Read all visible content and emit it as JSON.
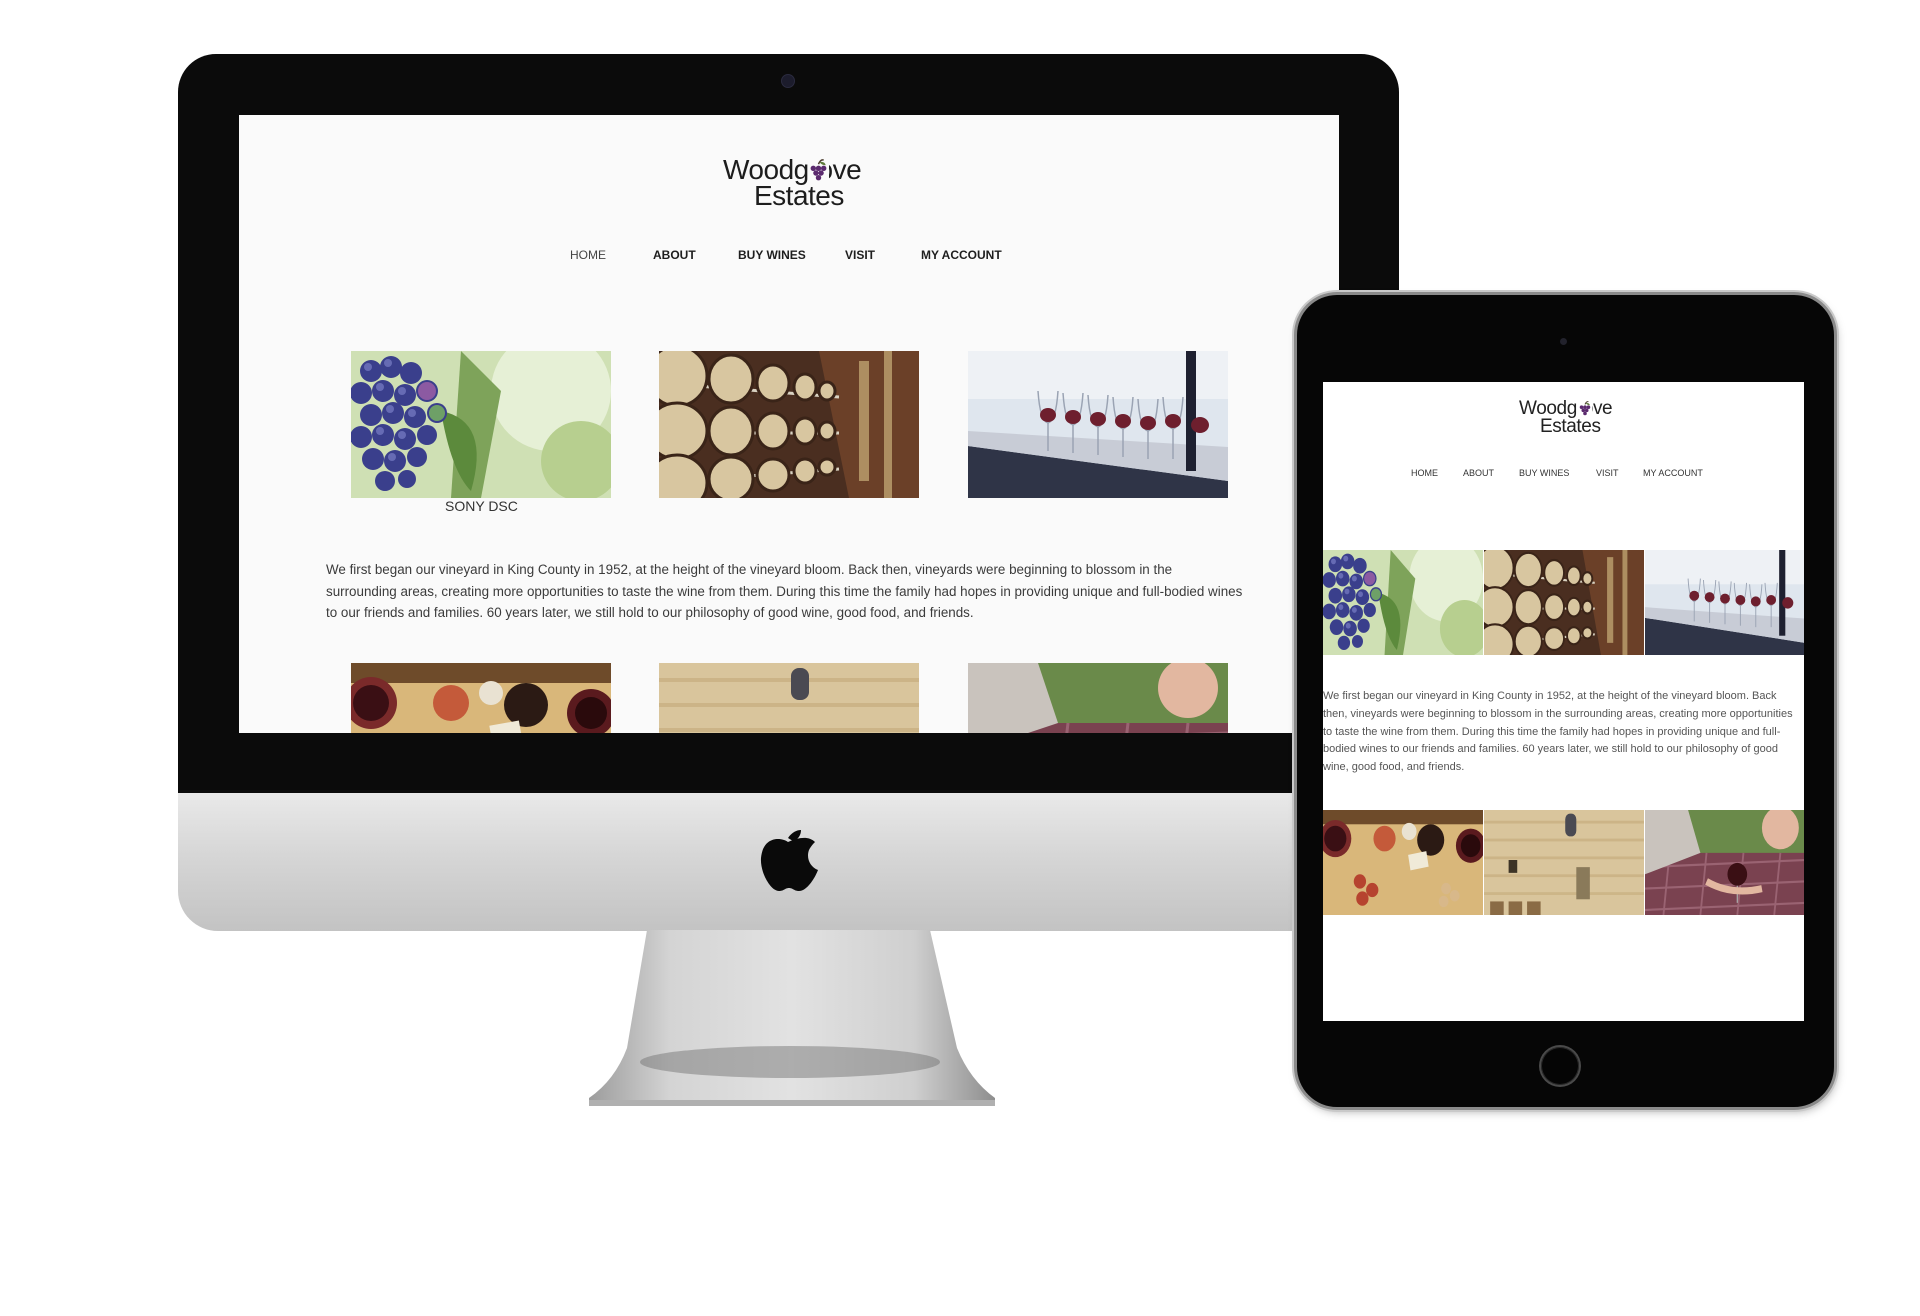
{
  "site": {
    "logo_line1": "Woodgrove",
    "logo_line2": "Estates",
    "nav": [
      "HOME",
      "ABOUT",
      "BUY WINES",
      "VISIT",
      "MY ACCOUNT"
    ],
    "caption": "SONY DSC",
    "intro": "We first began our vineyard in King County in 1952, at the height of the vineyard bloom. Back then, vineyards were beginning to blossom in the surrounding areas, creating more opportunities to taste the wine from them. During this time the family had hopes in providing unique and full-bodied wines to our friends and families. 60 years later, we still hold to our philosophy of good wine, good food, and friends."
  },
  "images": [
    "grapes-photo",
    "wine-barrels-photo",
    "wine-glasses-photo",
    "wine-tasting-table-photo",
    "stone-building-photo",
    "picnic-photo"
  ],
  "colors": {
    "page_bg": "#fafafa",
    "nav_text": "#1e1e1e",
    "body_text": "#3b3b3b",
    "grape_accent": "#5b2a6e"
  }
}
